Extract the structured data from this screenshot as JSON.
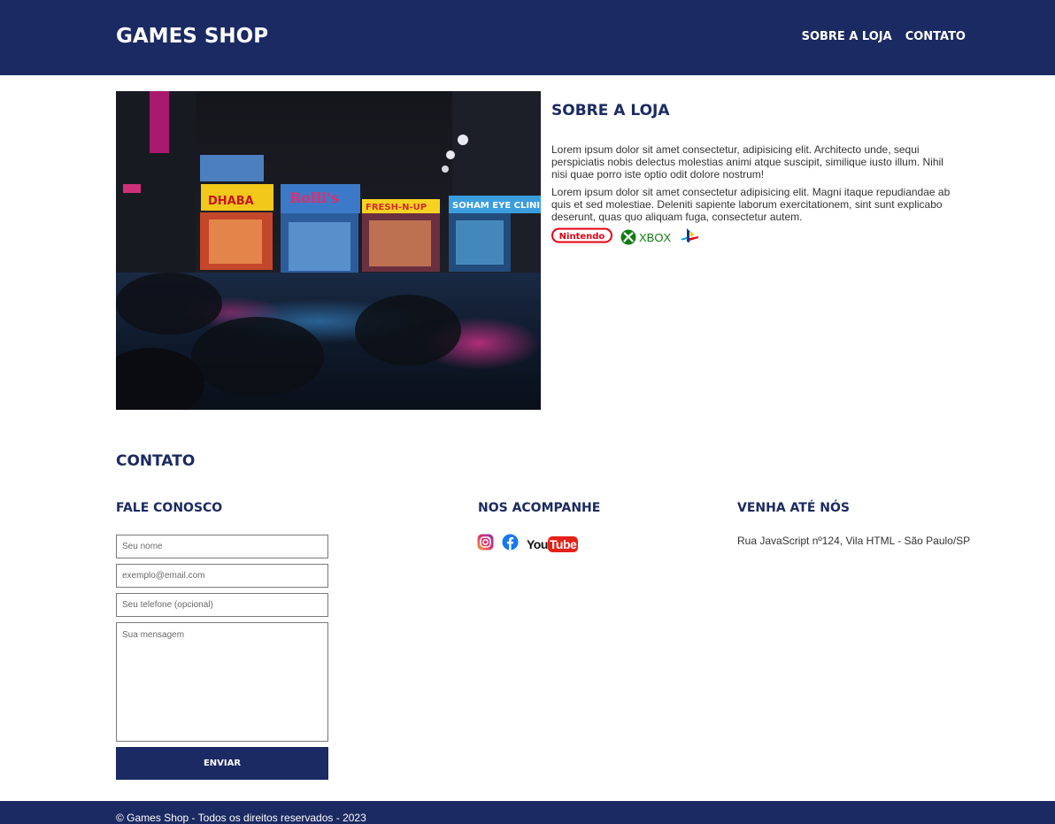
{
  "header": {
    "logo": "GAMES SHOP",
    "nav": [
      "SOBRE A LOJA",
      "CONTATO"
    ]
  },
  "about": {
    "title": "SOBRE A LOJA",
    "paragraph1": "Lorem ipsum dolor sit amet consectetur, adipisicing elit. Architecto unde, sequi perspiciatis nobis delectus molestias animi atque suscipit, similique iusto illum. Nihil nisi quae porro iste optio odit dolore nostrum!",
    "paragraph2": "Lorem ipsum dolor sit amet consectetur adipisicing elit. Magni itaque repudiandae ab quis et sed molestiae. Deleniti sapiente laborum exercitationem, sint sunt explicabo deserunt, quas quo aliquam fuga, consectetur autem.",
    "brands": {
      "nintendo": "Nintendo",
      "xbox": "XBOX"
    },
    "image_icon": "night-street-photo"
  },
  "contact": {
    "title": "CONTATO",
    "form": {
      "title": "FALE CONOSCO",
      "name_placeholder": "Seu nome",
      "email_placeholder": "exemplo@email.com",
      "phone_placeholder": "Seu telefone (opcional)",
      "message_placeholder": "Sua mensagem",
      "submit_label": "ENVIAR"
    },
    "social": {
      "title": "NOS ACOMPANHE",
      "icons": [
        "instagram-icon",
        "facebook-icon",
        "youtube-icon"
      ],
      "youtube_text_you": "You",
      "youtube_text_tube": "Tube"
    },
    "location": {
      "title": "VENHA ATÉ NÓS",
      "address": "Rua JavaScript nº124, Vila HTML - São Paulo/SP"
    }
  },
  "footer": {
    "copyright": "© Games Shop - Todos os direitos reservados - 2023"
  },
  "colors": {
    "brand": "#1b2a62",
    "nintendo": "#e60012",
    "xbox": "#107c10",
    "facebook": "#1877f2",
    "youtube": "#e62117"
  }
}
